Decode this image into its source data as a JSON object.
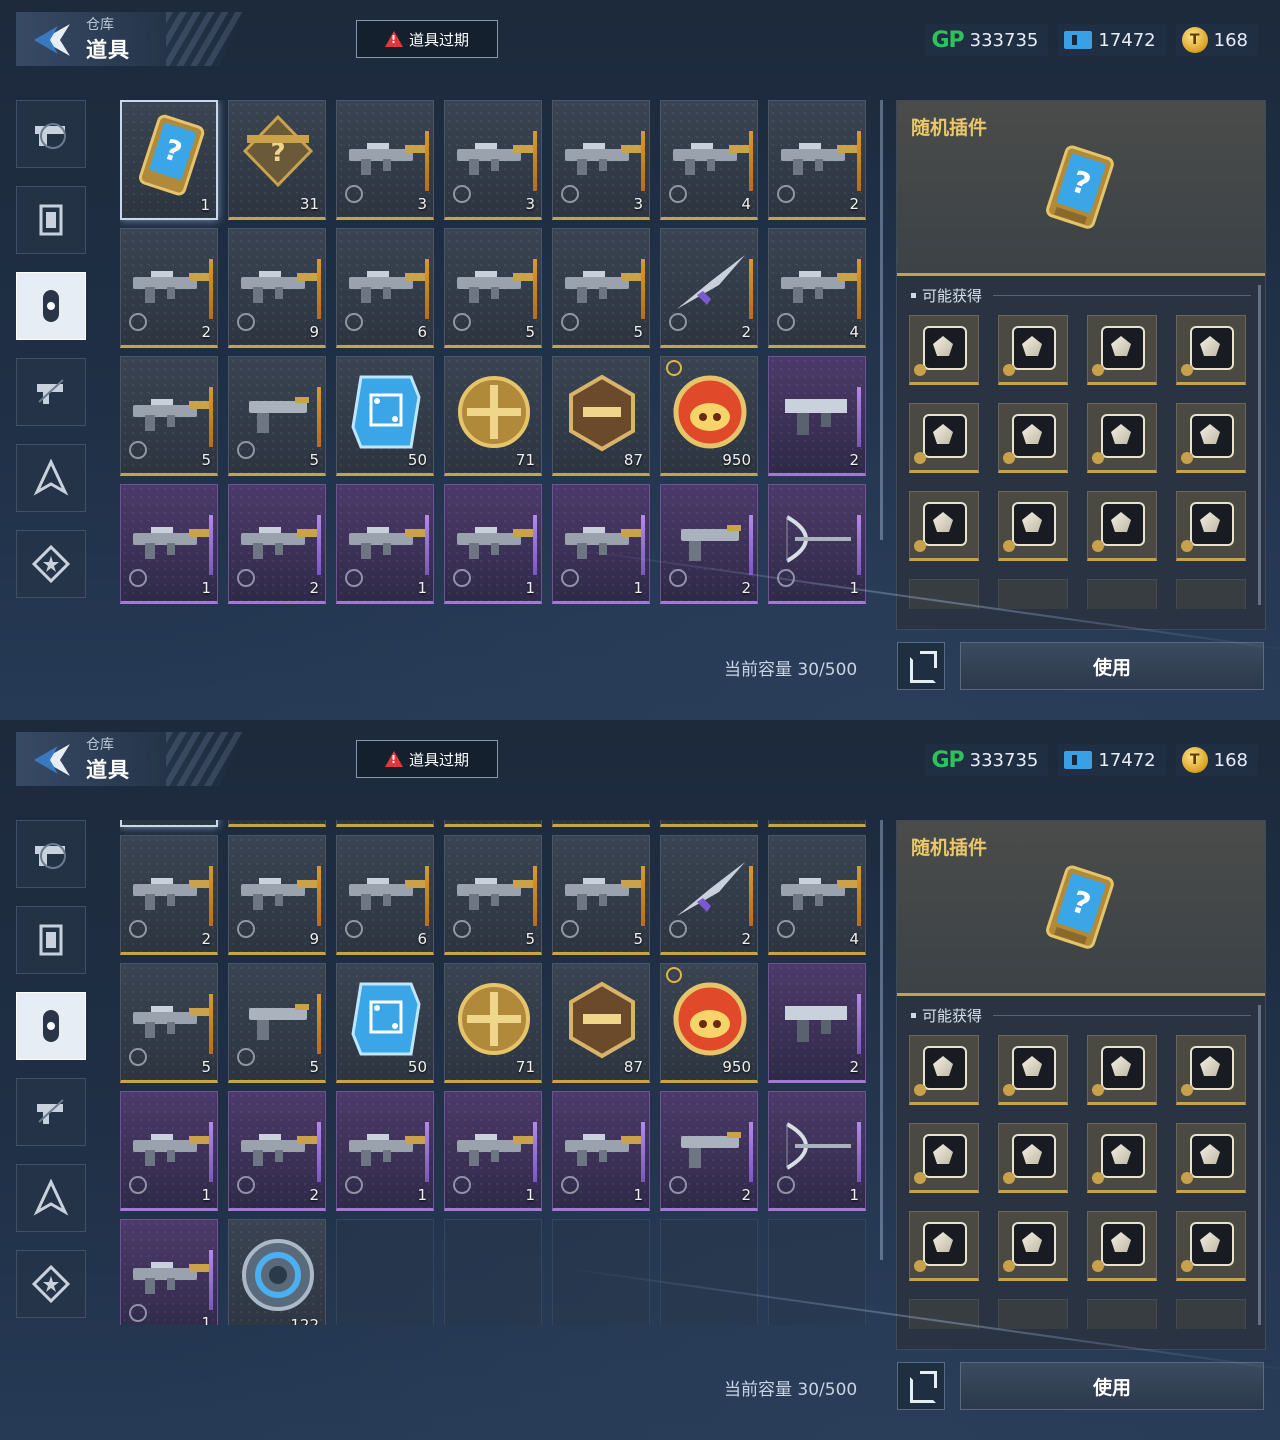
{
  "header": {
    "breadcrumb": "仓库",
    "title": "道具",
    "expire_button": "道具过期"
  },
  "currencies": [
    {
      "name": "gp",
      "icon": "gp-icon",
      "label": "GP",
      "value": "333735"
    },
    {
      "name": "ticket",
      "icon": "ticket-icon",
      "value": "17472"
    },
    {
      "name": "coin",
      "icon": "coin-icon",
      "value": "168"
    }
  ],
  "sidebar": {
    "tabs": [
      "gun-icon",
      "frame-icon",
      "capsule-icon",
      "gun-transform-icon",
      "compass-icon",
      "star-badge-icon"
    ],
    "active_index": 2
  },
  "inventory": {
    "capacity_text": "当前容量 30/500",
    "items": [
      {
        "qty": "1",
        "kind": "chip",
        "rarity": "gold",
        "clock": false
      },
      {
        "qty": "31",
        "kind": "blueprint",
        "rarity": "gold",
        "clock": false
      },
      {
        "qty": "3",
        "kind": "rifle",
        "rarity": "gold",
        "clock": true
      },
      {
        "qty": "3",
        "kind": "rifle",
        "rarity": "gold",
        "clock": true
      },
      {
        "qty": "3",
        "kind": "rifle",
        "rarity": "gold",
        "clock": true
      },
      {
        "qty": "4",
        "kind": "rifle",
        "rarity": "gold",
        "clock": true
      },
      {
        "qty": "2",
        "kind": "rifle",
        "rarity": "gold",
        "clock": true
      },
      {
        "qty": "2",
        "kind": "rifle",
        "rarity": "gold",
        "clock": true
      },
      {
        "qty": "9",
        "kind": "rifle",
        "rarity": "gold",
        "clock": true
      },
      {
        "qty": "6",
        "kind": "rifle",
        "rarity": "gold",
        "clock": true
      },
      {
        "qty": "5",
        "kind": "rifle",
        "rarity": "gold",
        "clock": true
      },
      {
        "qty": "5",
        "kind": "rifle",
        "rarity": "gold",
        "clock": true
      },
      {
        "qty": "2",
        "kind": "blade",
        "rarity": "gold",
        "clock": true
      },
      {
        "qty": "4",
        "kind": "rifle",
        "rarity": "gold",
        "clock": true
      },
      {
        "qty": "5",
        "kind": "rifle",
        "rarity": "gold",
        "clock": true
      },
      {
        "qty": "5",
        "kind": "pistol",
        "rarity": "gold",
        "clock": true
      },
      {
        "qty": "50",
        "kind": "circuit",
        "rarity": "gold",
        "clock": false
      },
      {
        "qty": "71",
        "kind": "gold-coin",
        "rarity": "gold",
        "clock": false
      },
      {
        "qty": "87",
        "kind": "hex-badge",
        "rarity": "gold",
        "clock": false
      },
      {
        "qty": "950",
        "kind": "pig-coin",
        "rarity": "gold",
        "clock": false,
        "timer": true
      },
      {
        "qty": "2",
        "kind": "smg",
        "rarity": "purple",
        "clock": false
      },
      {
        "qty": "1",
        "kind": "rifle",
        "rarity": "purple",
        "clock": true
      },
      {
        "qty": "2",
        "kind": "rifle",
        "rarity": "purple",
        "clock": true
      },
      {
        "qty": "1",
        "kind": "rifle",
        "rarity": "purple",
        "clock": true
      },
      {
        "qty": "1",
        "kind": "rifle",
        "rarity": "purple",
        "clock": true
      },
      {
        "qty": "1",
        "kind": "rifle",
        "rarity": "purple",
        "clock": true
      },
      {
        "qty": "2",
        "kind": "pistol",
        "rarity": "purple",
        "clock": true
      },
      {
        "qty": "1",
        "kind": "bow",
        "rarity": "purple",
        "clock": true
      },
      {
        "qty": "1",
        "kind": "rifle",
        "rarity": "purple",
        "clock": true
      },
      {
        "qty": "122",
        "kind": "blue-token",
        "rarity": "none",
        "clock": false
      }
    ],
    "selected_index": 0
  },
  "detail": {
    "title": "随机插件",
    "obtain_label": "可能获得",
    "rewards": [
      "plugin-1",
      "plugin-2",
      "plugin-3",
      "plugin-4",
      "plugin-5",
      "plugin-6",
      "plugin-7",
      "plugin-8",
      "plugin-9",
      "plugin-10",
      "plugin-11",
      "plugin-12"
    ],
    "use_button": "使用"
  },
  "colors": {
    "accent_gold": "#c7a14c",
    "rarity_purple": "#a678d6",
    "gp_green": "#2ec25a",
    "warning_red": "#e0393b"
  }
}
